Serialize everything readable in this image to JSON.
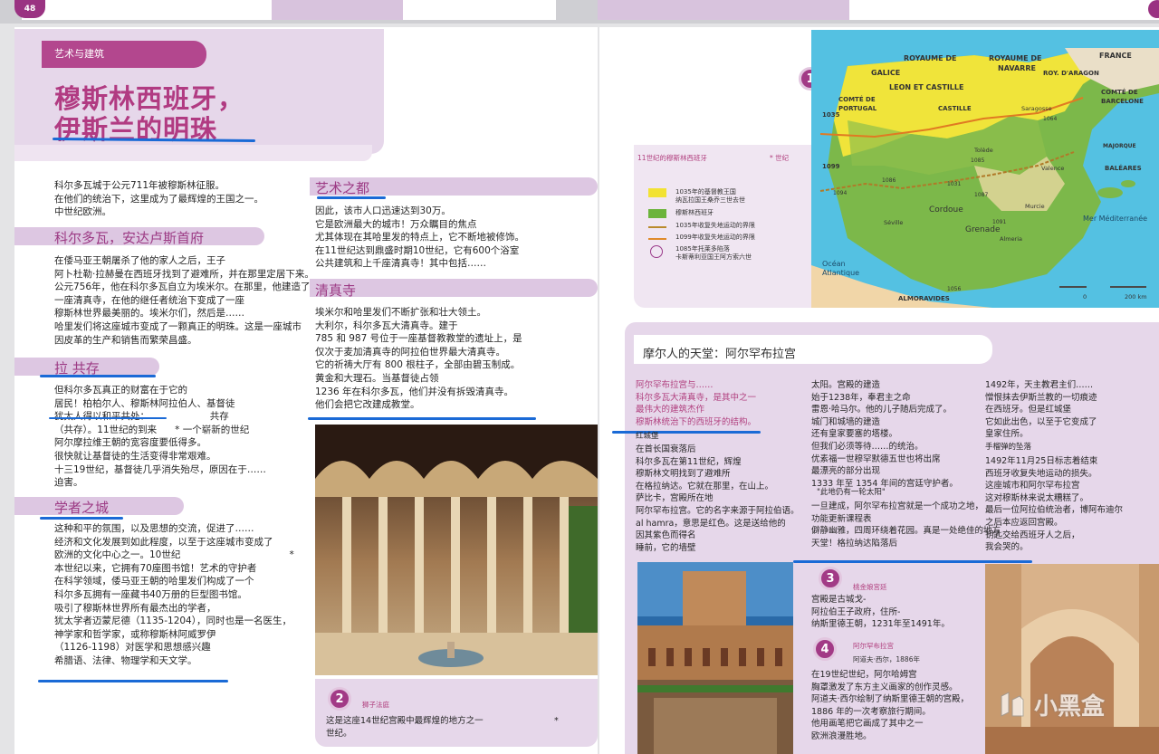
{
  "page_number": "48",
  "left": {
    "category": "艺术与建筑",
    "title_line1": "穆斯林西班牙，",
    "title_line2": "伊斯兰的明珠",
    "intro": "科尔多瓦城于公元711年被穆斯林征服。\n在他们的统治下，这里成为了最辉煌的王国之一。\n中世纪欧洲。",
    "sec1_title": "科尔多瓦，安达卢斯首府",
    "sec1_text": "在倭马亚王朝屠杀了他的家人之后，王子\n阿卜杜勒·拉赫曼在西班牙找到了避难所，并在那里定居下来。\n公元756年，他在科尔多瓦自立为埃米尔。在那里，他建造了一座建筑。\n一座清真寺，在他的继任者统治下变成了一座\n穆斯林世界最美丽的。埃米尔们，然后是……\n哈里发们将这座城市变成了一颗真正的明珠。这是一座城市\n因皮革的生产和销售而繁荣昌盛。",
    "sec2_title": "拉 共存",
    "sec2_text": "但科尔多瓦真正的财富在于它的\n居民！柏柏尔人、穆斯林阿拉伯人、基督徒\n犹太人得以和平共处：                    共存\n（共存）。11世纪的到来      * 一个崭新的世纪\n阿尔摩拉维王朝的宽容度要低得多。\n很快就让基督徒的生活变得非常艰难。\n十三19世纪，基督徒几乎消失殆尽，原因在于……\n迫害。",
    "sec3_title": "学者之城",
    "sec3_text": "这种和平的氛围，以及思想的交流，促进了……\n经济和文化发展到如此程度，以至于这座城市变成了\n欧洲的文化中心之一。10世纪                                    *\n本世纪以来，它拥有70座图书馆！艺术的守护者\n在科学领域，倭马亚王朝的哈里发们构成了一个\n科尔多瓦拥有一座藏书40万册的巨型图书馆。\n吸引了穆斯林世界所有最杰出的学者，\n犹太学者迈蒙尼德（1135-1204），同时也是一名医生，\n神学家和哲学家，或称穆斯林阿威罗伊\n（1126-1198）对医学和思想感兴趣\n希腊语、法律、物理学和天文学。",
    "sec4_title": "艺术之都",
    "sec4_text": "因此，该市人口迅速达到30万。\n它是欧洲最大的城市！万众瞩目的焦点\n尤其体现在其哈里发的特点上，它不断地被修饰。\n在11世纪达到鼎盛时期10世纪，它有600个浴室\n公共建筑和上千座清真寺！其中包括……",
    "sec5_title": "清真寺",
    "sec5_text": "埃米尔和哈里发们不断扩张和壮大领土。\n大利尔，科尔多瓦大清真寺。建于\n785 和 987 号位于一座基督教教堂的遗址上，是\n仅次于麦加清真寺的阿拉伯世界最大清真寺。\n它的祈祷大厅有 800 根柱子，全部由碧玉制成。\n黄金和大理石。当基督徒占领\n1236 年在科尔多瓦，他们并没有拆毁清真寺。\n他们会把它改建成教堂。",
    "cap2_num": "2",
    "cap2_title": "狮子法庭",
    "cap2_text": "这是这座14世纪宫殿中最辉煌的地方之一\n世纪。",
    "cap2_star": "*"
  },
  "map": {
    "badge": "1",
    "legend_title": "11世纪的穆斯林西班牙",
    "legend_note": "* 世纪",
    "legend_items": [
      {
        "label": "1035年的基督教王国\n纳瓦拉国王桑乔三世去世",
        "color": "#f2e233"
      },
      {
        "label": "穆斯林西班牙",
        "color": "#6cb43c"
      },
      {
        "label": "1035年收复失地运动的界限",
        "color": "#b98a2c"
      },
      {
        "label": "1099年收复失地运动的界限",
        "color": "#e08a2a"
      },
      {
        "label": "1085年托莱多陷落\n卡斯蒂利亚国王阿方索六世",
        "color": "#9a3a8a"
      }
    ],
    "regions": [
      "GALICE",
      "ROYAUME DE",
      "LEON ET CASTILLE",
      "ROYAUME DE",
      "NAVARRE",
      "ROY. D'ARAGON",
      "FRANCE",
      "COMTÉ DE PORTUGAL",
      "CASTILLE",
      "COMTÉ DE BARCELONE",
      "Cordoue",
      "Grenade",
      "Mer Méditerranée",
      "Océan Atlantique",
      "ALMORAVIDES",
      "MAJORQUE",
      "BALÉARES",
      "Séville",
      "Tolède",
      "Valence",
      "Saragosse",
      "Almeria",
      "Murcie"
    ],
    "years": [
      "1035",
      "1099",
      "1085",
      "1064",
      "1086",
      "1094",
      "1087",
      "1091",
      "1056",
      "1031"
    ],
    "scale": "200 km",
    "scale_zero": "0"
  },
  "right": {
    "box_title": "摩尔人的天堂：阿尔罕布拉宫",
    "col1_highlight": "阿尔罕布拉宫与……\n科尔多瓦大清真寺，是其中之一\n最伟大的建筑杰作\n穆斯林统治下的西班牙的结构。",
    "col1_sub": "红城堡",
    "col1_text": "在首长国衰落后\n科尔多瓦在第11世纪，辉煌\n穆斯林文明找到了避难所\n在格拉纳达。它就在那里，在山上。\n萨比卡，宫殿所在地\n阿尔罕布拉宫。它的名字来源于阿拉伯语。\nal hamra，意思是红色。这是送给他的\n因其紫色而得名\n睡前，它的墙壁",
    "col2_text": "太阳。宫殿的建造\n始于1238年，奉君主之命\n雷恩·哈马尔。他的儿子随后完成了。\n城门和城墙的建造\n还有皇家要塞的塔楼。\n但我们必须等待……的统治。\n优素福一世穆罕默德五世也将出席\n最漂亮的部分出现\n1333 年至 1354 年间的宫廷守护者。",
    "col2_sub": "\"此地仍有一轮太阳\"",
    "col2_text2": "一旦建成，阿尔罕布拉宫就是一个成功之地，\n功能更新课程表\n僻静幽雅，四周环绕着花园。真是一处绝佳的地方\n天堂！格拉纳达陷落后",
    "col3_text": "1492年，天主教君主们……\n憎恨抹去伊斯兰教的一切痕迹\n在西班牙。但是红城堡\n它如此出色，以至于它变成了\n皇家住所。",
    "col3_sub": "手榴弹的坠落",
    "col3_text2": "1492年11月25日标志着结束\n西班牙收复失地运动的损失。\n这座城市和阿尔罕布拉宫\n这对穆斯林来说太糟糕了。\n最后一位阿拉伯统治者，博阿布迪尔\n之后本应返回宫殿。\n钥匙交给西班牙人之后，\n我会哭的。",
    "cap3_num": "3",
    "cap3_title": "桃金娘宫廷",
    "cap3_text": "宫殿是古城戈-\n阿拉伯王子政府，住所-\n纳斯里德王朝，1231年至1491年。",
    "cap4_num": "4",
    "cap4_title": "阿尔罕布拉宫",
    "cap4_sub": "阿道夫·西尔，1886年",
    "cap4_text": "在19世纪世纪，阿尔哈姆宫\n胸罩激发了东方主义画家的创作灵感。\n阿道夫·西尔绘制了纳斯里德王朝的宫殿，\n1886 年的一次考察旅行期间。\n他用画笔把它画成了其中之一\n欧洲浪漫胜地。"
  },
  "watermark": "小黑盒"
}
